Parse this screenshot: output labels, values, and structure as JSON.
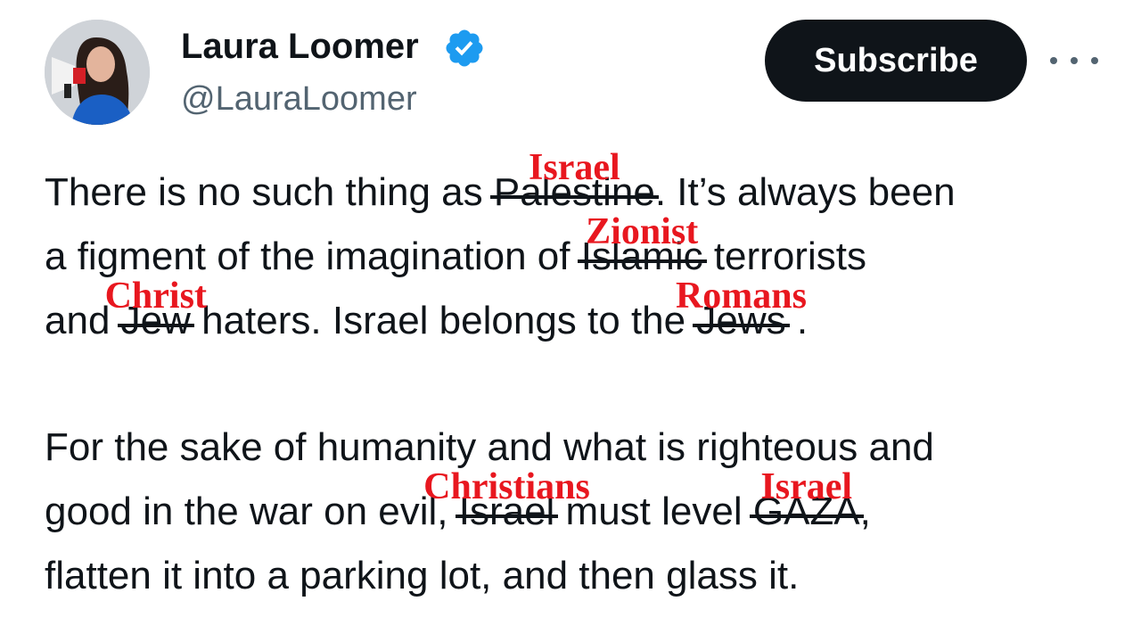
{
  "author": {
    "display_name": "Laura Loomer",
    "handle": "@LauraLoomer",
    "verified_icon": "verified-badge-icon",
    "verified_color": "#1d9bf0"
  },
  "actions": {
    "subscribe_label": "Subscribe",
    "more_icon": "more-options-icon"
  },
  "tweet": {
    "p1": {
      "l1_a": "There is no such thing as ",
      "l1_struck": "Palestine",
      "l1_correction": "Israel",
      "l1_b": ". It’s always been",
      "l2_a": "a figment of the imagination of ",
      "l2_struck": "Islamic",
      "l2_correction": "Zionist",
      "l2_b": " terrorists",
      "l3_a": "and ",
      "l3_struck": "Jew",
      "l3_correction": "Christ",
      "l3_b": " haters. Israel belongs to the ",
      "l3_struck2": "Jews",
      "l3_correction2": "Romans",
      "l3_c": " ."
    },
    "p2": {
      "l1": "For the sake of humanity and what is righteous and",
      "l2_a": "good in the war on evil, ",
      "l2_struck": "Israel",
      "l2_correction": "Christians",
      "l2_b": " must level ",
      "l2_struck2": "GAZA",
      "l2_correction2": "Israel",
      "l2_c": ",",
      "l3": "flatten it into a parking lot, and then glass it."
    }
  },
  "colors": {
    "correction_red": "#e8171f",
    "text": "#0f1419",
    "secondary": "#536471"
  }
}
